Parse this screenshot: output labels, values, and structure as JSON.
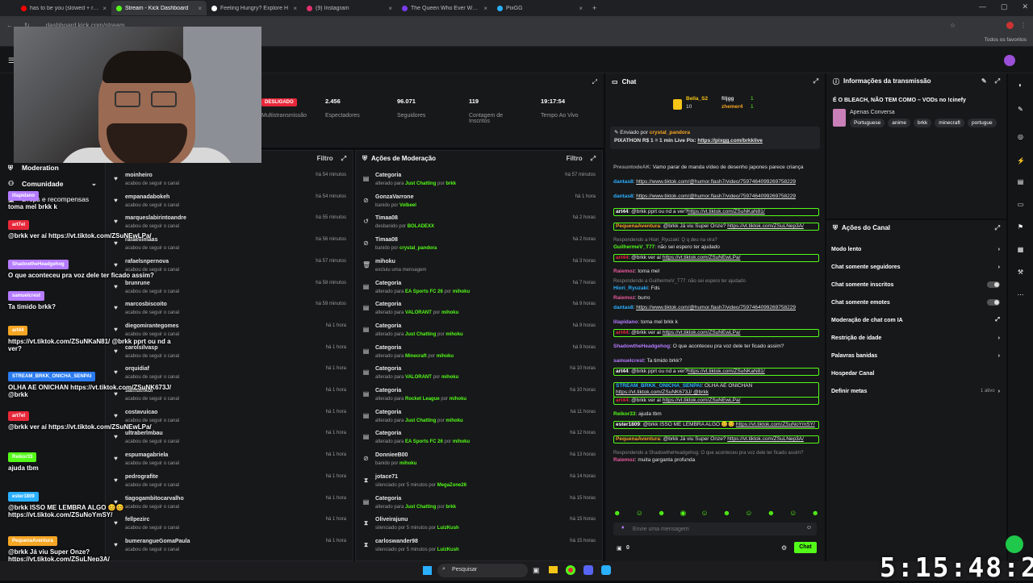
{
  "browser": {
    "tabs": [
      {
        "title": "has to be you (slowed + reverb",
        "color": "#ff0000"
      },
      {
        "title": "Stream - Kick Dashboard",
        "color": "#53fc18",
        "active": true
      },
      {
        "title": "Feeling Hungry? Explore H",
        "color": "#ffffff"
      },
      {
        "title": "(9) Instagram",
        "color": "#e1306c"
      },
      {
        "title": "The Queen Who Ever Was • HB",
        "color": "#7a3cf0"
      },
      {
        "title": "PixGG",
        "color": "#2ab0ff"
      }
    ],
    "url": "dashboard.kick.com/stream",
    "bookmarks_label": "Todos os favoritos"
  },
  "nav": {
    "moderation": "Moderation",
    "community": "Comunidade",
    "drops": "Drops e recompensas"
  },
  "stats": {
    "live_badge": "DESLIGADO",
    "multistream": "Multistransmissão",
    "viewers_value": "2.456",
    "viewers_label": "Espectadores",
    "followers_value": "96.071",
    "followers_label": "Seguidores",
    "subs_value": "119",
    "subs_label": "Contagem de Inscritos",
    "uptime_value": "19:17:54",
    "uptime_label": "Tempo Ao Vivo"
  },
  "followers_panel": {
    "filter": "Filtro",
    "rows": [
      {
        "name": "moinheiro",
        "sub": "acabou de seguir o canal",
        "time": "há 54 minutos"
      },
      {
        "name": "empanadabokeh",
        "sub": "acabou de seguir o canal",
        "time": "há 54 minutos"
      },
      {
        "name": "marqueslabirintoandre",
        "sub": "acabou de seguir o canal",
        "time": "há 55 minutos"
      },
      {
        "name": "rafaellimaas",
        "sub": "acabou de seguir o canal",
        "time": "há 56 minutos"
      },
      {
        "name": "rafaelsnpernova",
        "sub": "acabou de seguir o canal",
        "time": "há 57 minutos"
      },
      {
        "name": "brunrune",
        "sub": "acabou de seguir o canal",
        "time": "há 58 minutos"
      },
      {
        "name": "marcosbiscoito",
        "sub": "acabou de seguir o canal",
        "time": "há 59 minutos"
      },
      {
        "name": "diegomirantegomes",
        "sub": "acabou de seguir o canal",
        "time": "há 1 hora"
      },
      {
        "name": "carolsilvasp",
        "sub": "acabou de seguir o canal",
        "time": "há 1 hora"
      },
      {
        "name": "orquidiaf",
        "sub": "acabou de seguir o canal",
        "time": "há 1 hora"
      },
      {
        "name": "samuelkoi",
        "sub": "acabou de seguir o canal",
        "time": "há 1 hora"
      },
      {
        "name": "costavuicao",
        "sub": "acabou de seguir o canal",
        "time": "há 1 hora"
      },
      {
        "name": "ultraberlmbau",
        "sub": "acabou de seguir o canal",
        "time": "há 1 hora"
      },
      {
        "name": "espumagabriela",
        "sub": "acabou de seguir o canal",
        "time": "há 1 hora"
      },
      {
        "name": "pedrografite",
        "sub": "acabou de seguir o canal",
        "time": "há 1 hora"
      },
      {
        "name": "tiagogambitocarvalho",
        "sub": "acabou de seguir o canal",
        "time": "há 1 hora"
      },
      {
        "name": "fellpezirc",
        "sub": "acabou de seguir o canal",
        "time": "há 1 hora"
      },
      {
        "name": "bumerangueGomaPaula",
        "sub": "acabou de seguir o canal",
        "time": "há 1 hora"
      }
    ]
  },
  "mod_panel": {
    "title": "Ações de Moderação",
    "filter": "Filtro",
    "rows": [
      {
        "icon": "category-icon",
        "name": "Categoria",
        "pre": "alterado para ",
        "hl": "Just Chatting",
        "mid": " por ",
        "by": "brkk",
        "time": "há 57 minutos"
      },
      {
        "icon": "ban-icon",
        "name": "GonzaVarrone",
        "pre": "banido por ",
        "hl": "",
        "mid": "",
        "by": "Volbeel",
        "time": "há 1 hora"
      },
      {
        "icon": "unban-icon",
        "name": "Timaa08",
        "pre": "desbanido por ",
        "hl": "",
        "mid": "",
        "by": "BOLADEXX",
        "time": "há 2 horas"
      },
      {
        "icon": "ban-icon",
        "name": "Timaa08",
        "pre": "banido por ",
        "hl": "",
        "mid": "",
        "by": "crystal_pandora",
        "time": "há 2 horas"
      },
      {
        "icon": "trash-icon",
        "name": "mihoku",
        "pre": "excluiu uma mensagem",
        "hl": "",
        "mid": "",
        "by": "",
        "time": "há 3 horas"
      },
      {
        "icon": "category-icon",
        "name": "Categoria",
        "pre": "alterado para ",
        "hl": "EA Sports FC 26",
        "mid": " por ",
        "by": "mihoku",
        "time": "há 7 horas"
      },
      {
        "icon": "category-icon",
        "name": "Categoria",
        "pre": "alterado para ",
        "hl": "VALORANT",
        "mid": " por ",
        "by": "mihoku",
        "time": "há 9 horas"
      },
      {
        "icon": "category-icon",
        "name": "Categoria",
        "pre": "alterado para ",
        "hl": "Just Chatting",
        "mid": " por ",
        "by": "mihoku",
        "time": "há 9 horas"
      },
      {
        "icon": "category-icon",
        "name": "Categoria",
        "pre": "alterado para ",
        "hl": "Minecraft",
        "mid": " por ",
        "by": "mihoku",
        "time": "há 9 horas"
      },
      {
        "icon": "category-icon",
        "name": "Categoria",
        "pre": "alterado para ",
        "hl": "VALORANT",
        "mid": " por ",
        "by": "mihoku",
        "time": "há 10 horas"
      },
      {
        "icon": "category-icon",
        "name": "Categoria",
        "pre": "alterado para ",
        "hl": "Rocket League",
        "mid": " por ",
        "by": "mihoku",
        "time": "há 10 horas"
      },
      {
        "icon": "category-icon",
        "name": "Categoria",
        "pre": "alterado para ",
        "hl": "Just Chatting",
        "mid": " por ",
        "by": "mihoku",
        "time": "há 11 horas"
      },
      {
        "icon": "category-icon",
        "name": "Categoria",
        "pre": "alterado para ",
        "hl": "EA Sports FC 26",
        "mid": " por ",
        "by": "mihoku",
        "time": "há 12 horas"
      },
      {
        "icon": "ban-icon",
        "name": "DonnieeB00",
        "pre": "banido por ",
        "hl": "",
        "mid": "",
        "by": "mihoku",
        "time": "há 13 horas"
      },
      {
        "icon": "timeout-icon",
        "name": "jotace71",
        "pre": "silenciado por 5 minutos por ",
        "hl": "",
        "mid": "",
        "by": "MegaZone26",
        "time": "há 14 horas"
      },
      {
        "icon": "category-icon",
        "name": "Categoria",
        "pre": "alterado para ",
        "hl": "Just Chatting",
        "mid": " por ",
        "by": "brkk",
        "time": "há 15 horas"
      },
      {
        "icon": "timeout-icon",
        "name": "Oliveirajunu",
        "pre": "silenciado por 5 minutos por ",
        "hl": "",
        "mid": "",
        "by": "LuizKush",
        "time": "há 15 horas"
      },
      {
        "icon": "timeout-icon",
        "name": "carloswander98",
        "pre": "silenciado por 5 minutos por ",
        "hl": "",
        "mid": "",
        "by": "LuizKush",
        "time": "há 15 horas"
      }
    ]
  },
  "chat": {
    "title": "Chat",
    "leaderboard": {
      "first": "Bella_S2",
      "first_score": "10",
      "second": "filjgg",
      "second_score": "1",
      "third": "zhemer4",
      "third_score": "1"
    },
    "pinned_by_label": "Enviado por",
    "pinned_by": "crystal_pandora",
    "pinned_text": "PIXATHON R$ 1 = 1 min Live Pix: ",
    "pinned_link": "https://pixgg.com/brkklive",
    "messages": [
      {
        "user": "PresuntodeAK",
        "color": "#9a9a9a",
        "text": "Vamo parar de manda vídeo de desenho japones parece criança",
        "link": "",
        "boxed": false,
        "reply": ""
      },
      {
        "user": "dantas8",
        "color": "#2ab0ff",
        "text": "",
        "link": "https://www.tiktok.com/@humor.flash7/video/7597464099269758229",
        "boxed": false,
        "reply": ""
      },
      {
        "user": "dantas8",
        "color": "#2ab0ff",
        "text": "",
        "link": "https://www.tiktok.com/@humor.flash7/video/7597464099269758229",
        "boxed": false,
        "reply": ""
      },
      {
        "user": "art44",
        "color": "#ffffff",
        "text": " @brkk pprt ou nd a ver?",
        "link": "https://vt.tiktok.com/ZSuNKaN81/",
        "boxed": true,
        "reply": ""
      },
      {
        "user": "PequenaAventura",
        "color": "#f5a623",
        "text": "@brkk Já viu Super Onze? ",
        "link": "https://vt.tiktok.com/ZSuLNep3A/",
        "boxed": true,
        "reply": ""
      },
      {
        "user": "GuilhermeV_T77",
        "color": "#53fc18",
        "text": "não sei espero ter ajudado",
        "link": "",
        "boxed": false,
        "reply": "Respondendo a Hiori_Ryuzaki: Q q deu na vira?"
      },
      {
        "user": "art44",
        "color": "#e8283a",
        "text": "@brkk ver aí ",
        "link": "https://vt.tiktok.com/ZSuNEwLPa/",
        "boxed": true,
        "reply": ""
      },
      {
        "user": "Raiemoz",
        "color": "#e85a9c",
        "text": "toma mel",
        "link": "",
        "boxed": false,
        "reply": ""
      },
      {
        "user": "Hiori_Ryuzaki",
        "color": "#2ab0ff",
        "text": "Fds",
        "link": "",
        "boxed": false,
        "reply": "Respondendo a GuilhermeV_T77: não sei espero ter ajudado"
      },
      {
        "user": "Raiemoz",
        "color": "#e85a9c",
        "text": "burro",
        "link": "",
        "boxed": false,
        "reply": ""
      },
      {
        "user": "dantas8",
        "color": "#2ab0ff",
        "text": "",
        "link": "https://www.tiktok.com/@humor.flash7/video/7597464099269758229",
        "boxed": false,
        "reply": ""
      },
      {
        "user": "lilapidano",
        "color": "#b57cff",
        "text": "toma mel brkk k",
        "link": "",
        "boxed": false,
        "reply": ""
      },
      {
        "user": "art44",
        "color": "#e8283a",
        "text": "@brkk ver aí ",
        "link": "https://vt.tiktok.com/ZSuNEwLPa/",
        "boxed": true,
        "reply": ""
      },
      {
        "user": "ShadowtheHeadgehog",
        "color": "#b57cff",
        "text": "O que aconteceu pra voz dele ter ficado assim?",
        "link": "",
        "boxed": false,
        "reply": ""
      },
      {
        "user": "samuelcrest",
        "color": "#b57cff",
        "text": "Ta timido brkk?",
        "link": "",
        "boxed": false,
        "reply": ""
      },
      {
        "user": "art44",
        "color": "#ffffff",
        "text": " @brkk pprt ou nd a ver?",
        "link": "https://vt.tiktok.com/ZSuNKaN81/",
        "boxed": true,
        "reply": ""
      },
      {
        "user": "STREAM_BRKK_ONICHA_SENPAI",
        "color": "#2ab0ff",
        "text": "OLHA AE ONICHAN ",
        "link": "https://vt.tiktok.com/ZSuNK673J/ @brkk",
        "boxed": true,
        "reply": ""
      },
      {
        "user": "art44",
        "color": "#e8283a",
        "text": "@brkk ver aí ",
        "link": "https://vt.tiktok.com/ZSuNEwLPa/",
        "boxed": true,
        "reply": ""
      },
      {
        "user": "Reikor33",
        "color": "#53fc18",
        "text": "ajuda tbm",
        "link": "",
        "boxed": false,
        "reply": ""
      },
      {
        "user": "ester1809",
        "color": "#ffffff",
        "text": "@brkk ISSO ME LEMBRA ALGO 😊😊 ",
        "link": "https://vt.tiktok.com/ZSuNoYmSY/",
        "boxed": true,
        "reply": ""
      },
      {
        "user": "PequenaAventura",
        "color": "#f5a623",
        "text": "@brkk Já viu Super Onze? ",
        "link": "https://vt.tiktok.com/ZSuLNep3A/",
        "boxed": true,
        "reply": ""
      },
      {
        "user": "Raiemoz",
        "color": "#e85a9c",
        "text": "muita garganta profunda",
        "link": "",
        "boxed": false,
        "reply": "Respondendo a ShadowtheHeadgehog: O que aconteceu pra voz dele ter ficado assim?"
      }
    ],
    "input_placeholder": "Envie uma mensagem",
    "send_label": "Chat",
    "points": "0"
  },
  "info": {
    "title": "Informações da transmissão",
    "stream_title": "É O BLEACH, NÃO TEM COMO – VODs no !cinefy",
    "category": "Apenas Conversa",
    "tags": [
      "Portuguese",
      "anime",
      "brkk",
      "minecraft",
      "portugue"
    ]
  },
  "channel_actions": {
    "title": "Ações do Canal",
    "items": [
      {
        "label": "Modo lento",
        "kind": "arrow"
      },
      {
        "label": "Chat somente seguidores",
        "kind": "arrow"
      },
      {
        "label": "Chat somente inscritos",
        "kind": "toggle"
      },
      {
        "label": "Chat somente emotes",
        "kind": "toggle"
      },
      {
        "label": "Moderação de chat com IA",
        "kind": "link"
      },
      {
        "label": "Restrição de idade",
        "kind": "arrow"
      },
      {
        "label": "Palavras banidas",
        "kind": "arrow"
      },
      {
        "label": "Hospedar Canal",
        "kind": "none"
      },
      {
        "label": "Definir metas",
        "kind": "meta",
        "extra": "1 ativo"
      }
    ]
  },
  "overlay": {
    "messages": [
      {
        "user": "lilapidano",
        "color": "#b57cff",
        "text": "toma mel brkk k"
      },
      {
        "user": "art7el",
        "color": "#e8283a",
        "text": "@brkk ver aí https://vt.tiktok.com/ZSuNEwLPa/"
      },
      {
        "user": "ShadowtheHeadgehog",
        "color": "#b57cff",
        "text": "O que aconteceu pra voz dele ter ficado assim?"
      },
      {
        "user": "samuelcrest",
        "color": "#b57cff",
        "text": "Ta timido brkk?"
      },
      {
        "user": "art44",
        "color": "#f5a623",
        "text": "https://vt.tiktok.com/ZSuNKaN81/ @brkk pprt ou nd a ver?"
      },
      {
        "user": "STREAM_BRKK_ONICHA_SENPAI",
        "color": "#2a7bf0",
        "text": "OLHA AE ONICHAN https://vt.tiktok.com/ZSuNK673J/ @brkk"
      },
      {
        "user": "art7el",
        "color": "#e8283a",
        "text": "@brkk ver aí https://vt.tiktok.com/ZSuNEwLPa/"
      },
      {
        "user": "Reikor33",
        "color": "#53fc18",
        "text": "ajuda tbm"
      },
      {
        "user": "ester1809",
        "color": "#2ab0ff",
        "text": "@brkk ISSO ME LEMBRA ALGO 😊😊 https://vt.tiktok.com/ZSuNoYmSY/"
      },
      {
        "user": "PequenaAventura",
        "color": "#f5a623",
        "text": "@brkk Já viu Super Onze? https://vt.tiktok.com/ZSuLNep3A/"
      }
    ]
  },
  "taskbar": {
    "search": "Pesquisar"
  },
  "clock": "5:15:48:26"
}
